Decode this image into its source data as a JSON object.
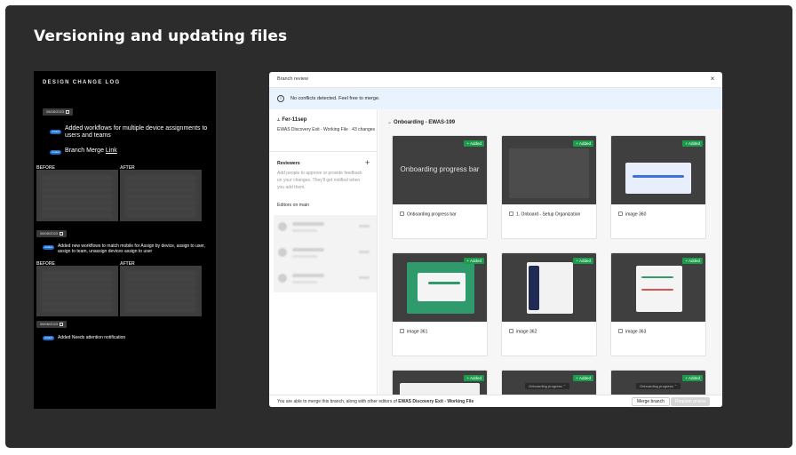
{
  "slide": {
    "title": "Versioning and updating files"
  },
  "change_log": {
    "title": "DESIGN CHANGE LOG",
    "entries": [
      {
        "date": "08/08/2023",
        "tag": "Added",
        "text": "Added workflows for multiple device assignments to users and teams",
        "tag2": "Added",
        "text2": "Branch Merge",
        "link": "Link"
      },
      {
        "date": "08/08/2023",
        "tag": "Added",
        "text": "Added new workflows to match mobile for Assign by device,  assign to user, assign to team,  unassign devices  assign to user"
      },
      {
        "date": "08/08/2023",
        "tag": "Added",
        "text": "Added  Needs attention notification"
      }
    ],
    "before_label": "BEFORE",
    "after_label": "AFTER"
  },
  "modal": {
    "title": "Branch review",
    "close_glyph": "×",
    "banner": "No conflicts detected. Feel free to merge.",
    "info_glyph": "i",
    "branch": {
      "icon": "⥿",
      "name": "Fer-11sep",
      "subtitle": "EWAS Discovery Exit - Working File · 43 changes"
    },
    "reviewers": {
      "label": "Reviewers",
      "add": "+",
      "hint": "Add people to approve or provide feedback on your changes. They'll get notified when you add them."
    },
    "editors_label": "Editors on main",
    "section": {
      "chevron": "⌄",
      "title": "Onboarding - EWAS-199"
    },
    "added_badge": "+ Added",
    "cards": [
      {
        "label": "Onboarding progress bar",
        "thumb_text": "Onboarding progress bar",
        "icon": "text-icon"
      },
      {
        "label": "1. Onboard - Setup Organization",
        "icon": "frame-icon"
      },
      {
        "label": "image 360",
        "icon": "image-icon"
      },
      {
        "label": "image 361",
        "icon": "image-icon"
      },
      {
        "label": "image 362",
        "icon": "image-icon"
      },
      {
        "label": "image 363",
        "icon": "image-icon"
      },
      {
        "label": "",
        "icon": "image-icon"
      },
      {
        "label": "",
        "caption": "Onboarding progress ⌃",
        "icon": "image-icon"
      },
      {
        "label": "",
        "caption": "Onboarding progress ⌃",
        "icon": "image-icon"
      }
    ],
    "footer": {
      "prefix": "You are able to merge this branch, along with other editors of",
      "file": "EWAS Discovery Exit - Working File",
      "merge": "Merge branch",
      "request": "Request review"
    }
  },
  "colors": {
    "slide_bg": "#2c2c2c",
    "added_green": "#1c9c4a",
    "banner_blue": "#e8f3fd",
    "tag_blue": "#1f6fd1"
  }
}
